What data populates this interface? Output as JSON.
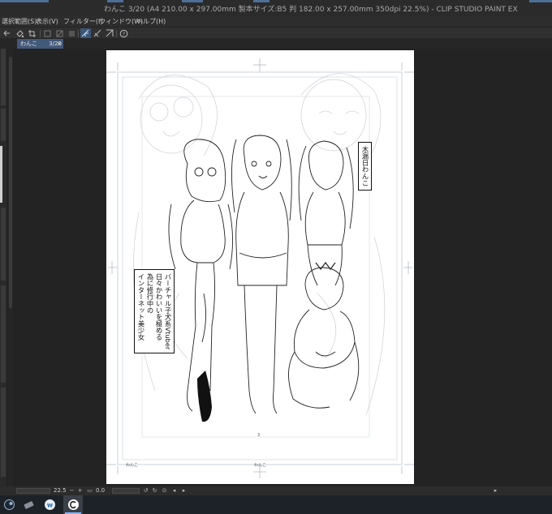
{
  "window": {
    "title": "わんこ 3/20 (A4 210.00 x 297.00mm 製本サイズ:B5 判 182.00 x 257.00mm 350dpi 22.5%)  - CLIP STUDIO PAINT EX"
  },
  "menu": {
    "items": [
      "選択範囲(S)",
      "表示(V)",
      "フィルター(I)",
      "ウィンドウ(W)",
      "ヘルプ(H)"
    ]
  },
  "document_tab": {
    "name": "わんこ",
    "page": "3/20",
    "close": "×"
  },
  "page": {
    "number": "3",
    "footer_left": "わんこ",
    "footer_center": "わんこ"
  },
  "speech": {
    "top_right": [
      "木漏日わんこ"
    ],
    "left": [
      "バーチャル子犬系Vtuber",
      "日々かわいいを極める",
      "為に修行中の",
      "インターネット美少女"
    ]
  },
  "status": {
    "zoom": "22.5",
    "rotation": "0.0"
  },
  "colors": {
    "accent": "#4d6f98",
    "tab": "#43597a",
    "canvas_bg": "#232323"
  }
}
